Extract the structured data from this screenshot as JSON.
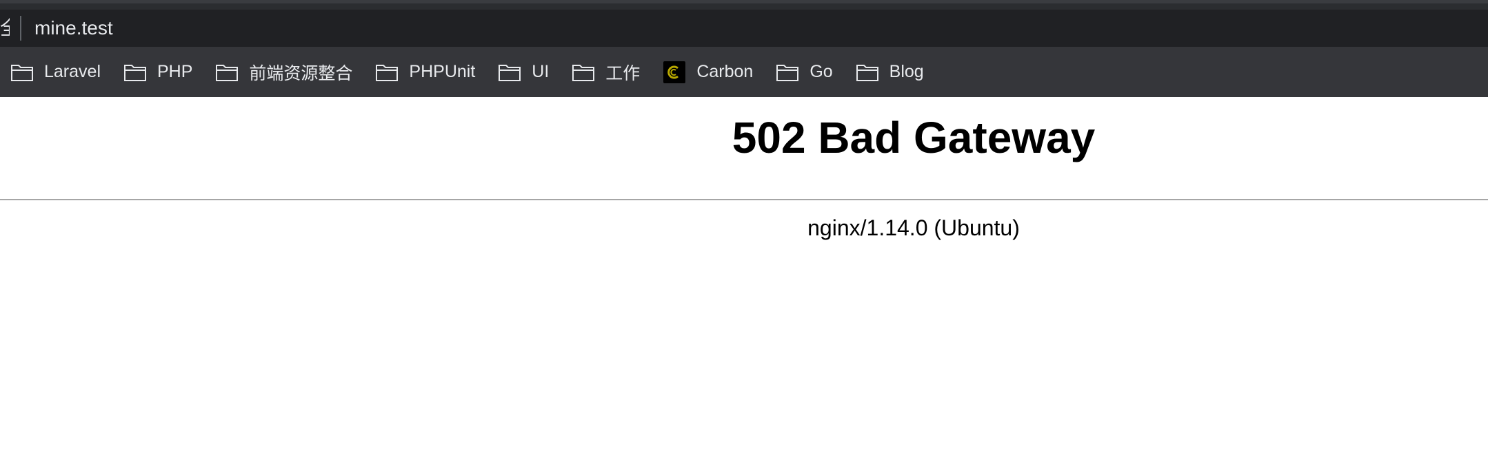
{
  "address_bar": {
    "security_fragment": "全",
    "url": "mine.test"
  },
  "bookmarks": [
    {
      "label": "Laravel",
      "icon": "folder-icon"
    },
    {
      "label": "PHP",
      "icon": "folder-icon"
    },
    {
      "label": "前端资源整合",
      "icon": "folder-icon"
    },
    {
      "label": "PHPUnit",
      "icon": "folder-icon"
    },
    {
      "label": "UI",
      "icon": "folder-icon"
    },
    {
      "label": "工作",
      "icon": "folder-icon"
    },
    {
      "label": "Carbon",
      "icon": "carbon-favicon-icon"
    },
    {
      "label": "Go",
      "icon": "folder-icon"
    },
    {
      "label": "Blog",
      "icon": "folder-icon"
    }
  ],
  "page": {
    "heading": "502 Bad Gateway",
    "server_info": "nginx/1.14.0 (Ubuntu)"
  },
  "colors": {
    "toolbar_bg": "#202124",
    "bookmarks_bg": "#35363a",
    "toolbar_text": "#e8eaed",
    "carbon_accent": "#b8a800"
  }
}
